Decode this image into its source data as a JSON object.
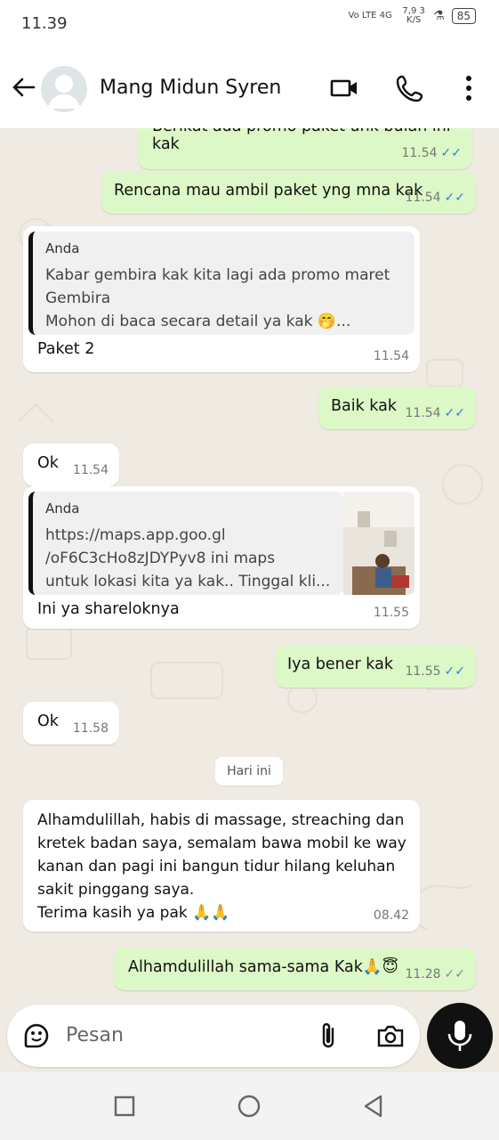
{
  "status_bar": {
    "time": "11.39",
    "network": "Vo LTE 4G",
    "speed": "7,9 3 K/S",
    "battery": "85"
  },
  "header": {
    "contact_name": "Mang Midun Syren"
  },
  "messages": [
    {
      "text": "Berikut ada promo paket unk bulan ini kak",
      "time": "11.54"
    },
    {
      "text": "Rencana mau ambil paket yng mna kak",
      "time": "11.54"
    },
    {
      "quote_author": "Anda",
      "quote_text": "Kabar gembira kak kita lagi ada promo maret\nGembira\nMohon di baca secara detail ya kak 🤭...",
      "text": "Paket 2",
      "time": "11.54"
    },
    {
      "text": "Baik kak",
      "time": "11.54"
    },
    {
      "text": "Ok",
      "time": "11.54"
    },
    {
      "quote_author": "Anda",
      "quote_text": "https://maps.app.goo.gl\n/oF6C3cHo8zJDYPyv8 ini maps\nuntuk lokasi kita ya kak.. Tinggal kli...",
      "text": "Ini ya shareloknya",
      "time": "11.55"
    },
    {
      "text": "Iya bener kak",
      "time": "11.55"
    },
    {
      "text": "Ok",
      "time": "11.58"
    },
    {
      "text": "Alhamdulillah, habis di massage, streaching dan\nkretek badan saya, semalam bawa mobil ke way\nkanan dan pagi ini bangun tidur hilang keluhan\nsakit pinggang saya.\nTerima kasih ya pak 🙏🙏",
      "time": "08.42"
    },
    {
      "text": "Alhamdulillah sama-sama Kak🙏😇",
      "time": "11.28"
    }
  ],
  "date_chip": "Hari ini",
  "input": {
    "placeholder": "Pesan"
  },
  "colors": {
    "outgoing": "#dcf8c6",
    "incoming": "#ffffff",
    "read_tick": "#2f7fd6",
    "background": "#efeae2"
  }
}
